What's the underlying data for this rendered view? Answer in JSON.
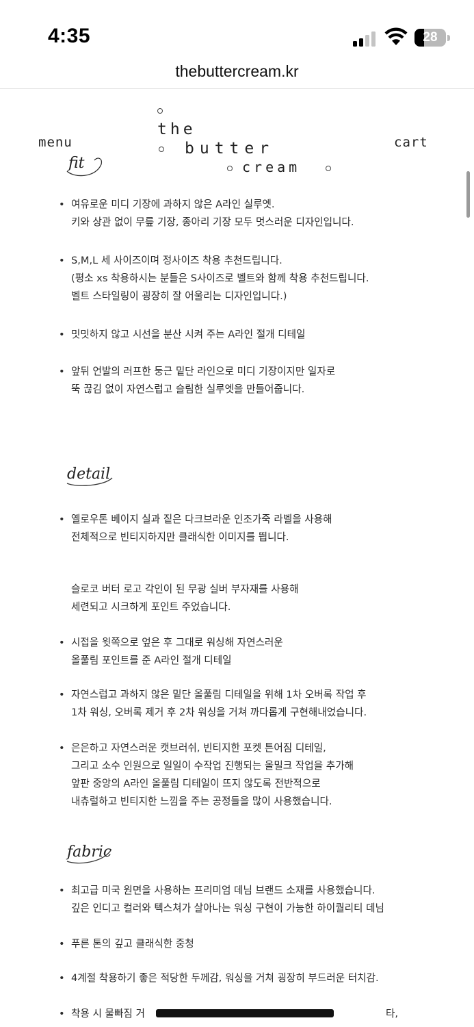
{
  "status_bar": {
    "time": "4:35",
    "battery_level": "28",
    "icons": [
      "signal-icon",
      "wifi-icon",
      "battery-icon"
    ]
  },
  "browser": {
    "url": "thebuttercream.kr"
  },
  "header": {
    "menu_label": "menu",
    "cart_label": "cart",
    "logo": {
      "line1": "the",
      "line2": "butter",
      "line3": "cream"
    }
  },
  "sections": {
    "fit": {
      "label": "fit",
      "items": [
        [
          "여유로운 미디 기장에 과하지 않은 A라인 실루엣.",
          "키와 상관 없이 무릎 기장, 종아리 기장 모두 멋스러운 디자인입니다."
        ],
        [
          "S,M,L 세 사이즈이며 정사이즈 착용 추천드립니다.",
          "(평소 xs 착용하시는 분들은 S사이즈로 벨트와 함께 착용 추천드립니다.",
          "벨트 스타일링이 굉장히 잘 어울리는 디자인입니다.)"
        ],
        [
          "밋밋하지 않고 시선을 분산 시켜 주는 A라인 절개 디테일"
        ],
        [
          "앞뒤 언발의 러프한 둥근 밑단 라인으로 미디 기장이지만 일자로",
          "뚝 끊김 없이 자연스럽고 슬림한 실루엣을 만들어줍니다."
        ]
      ]
    },
    "detail": {
      "label": "detail",
      "items": [
        [
          "옐로우톤 베이지 실과 짙은 다크브라운 인조가죽 라벨을 사용해",
          "전체적으로 빈티지하지만 클래식한 이미지를 띕니다."
        ]
      ],
      "paragraph": [
        "슬로코 버터 로고 각인이 된 무광 실버 부자재를 사용해",
        "세련되고 시크하게 포인트 주었습니다."
      ],
      "items2": [
        [
          "시접을 윗쪽으로 엎은 후 그대로 워싱해 자연스러운",
          "올풀림 포인트를 준 A라인 절개 디테일"
        ],
        [
          "자연스럽고 과하지 않은 밑단 올풀림 디테일을 위해 1차 오버록 작업 후",
          "1차 워싱, 오버록 제거 후 2차 워싱을 거쳐 까다롭게 구현해내었습니다."
        ],
        [
          "은은하고 자연스러운 캣브러쉬, 빈티지한 포켓 튼어짐 디테일,",
          "그리고 소수 인원으로 일일이 수작업 진행되는 올밀크 작업을 추가해",
          "앞판 중앙의 A라인 올풀림 디테일이 뜨지 않도록 전반적으로",
          "내츄럴하고 빈티지한 느낌을 주는 공정들을 많이 사용했습니다."
        ]
      ]
    },
    "fabric": {
      "label": "fabric",
      "items": [
        [
          "최고급 미국 원면을 사용하는 프리미엄 데님 브랜드 소재를 사용했습니다.",
          "깊은 인디고 컬러와 텍스쳐가 살아나는 워싱 구현이 가능한 하이퀄리티 데님"
        ],
        [
          "푸른 톤의 깊고 클래식한 중청"
        ],
        [
          "4계절 착용하기 좋은 적당한 두께감, 워싱을 거쳐 굉장히 부드러운 터치감."
        ],
        [
          "착용 시 물빠짐 거",
          "타,"
        ]
      ]
    }
  },
  "bullet": "•"
}
